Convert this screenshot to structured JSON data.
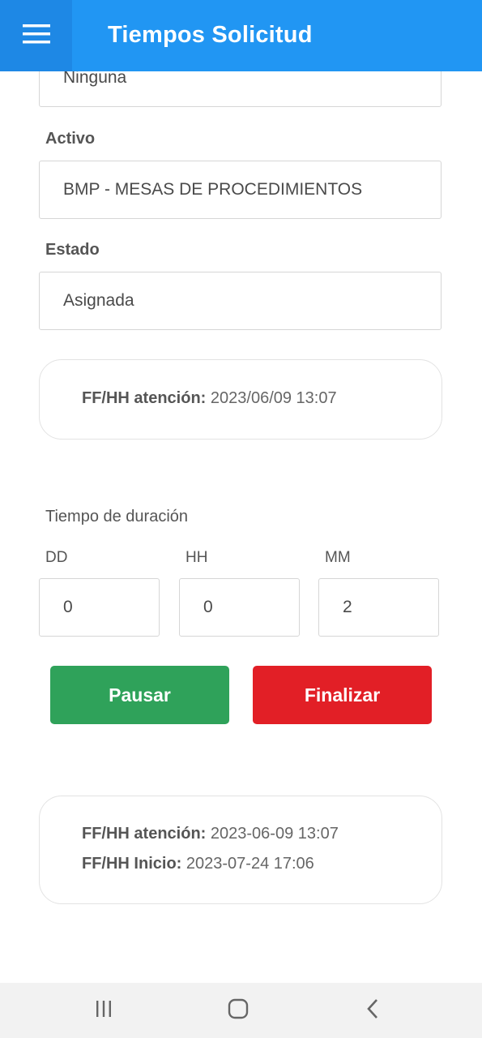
{
  "header": {
    "title": "Tiempos Solicitud",
    "menu_icon": "hamburger-menu-icon"
  },
  "form": {
    "prev_field_value": "Ninguna",
    "activo_label": "Activo",
    "activo_value": "BMP - MESAS DE PROCEDIMIENTOS",
    "estado_label": "Estado",
    "estado_value": "Asignada"
  },
  "info_card": {
    "atencion_label": "FF/HH atención:",
    "atencion_value": "2023/06/09 13:07"
  },
  "duration": {
    "title": "Tiempo de duración",
    "dd_label": "DD",
    "hh_label": "HH",
    "mm_label": "MM",
    "dd_value": "0",
    "hh_value": "0",
    "mm_value": "2"
  },
  "actions": {
    "pause_label": "Pausar",
    "finish_label": "Finalizar"
  },
  "summary_card": {
    "atencion_label": "FF/HH atención:",
    "atencion_value": "2023-06-09 13:07",
    "inicio_label": "FF/HH Inicio:",
    "inicio_value": "2023-07-24 17:06"
  },
  "navbar": {
    "icons": [
      "recent-apps-icon",
      "home-icon",
      "back-icon"
    ]
  },
  "colors": {
    "appbar": "#2196f3",
    "pause": "#2fa25a",
    "finish": "#e21f26"
  }
}
